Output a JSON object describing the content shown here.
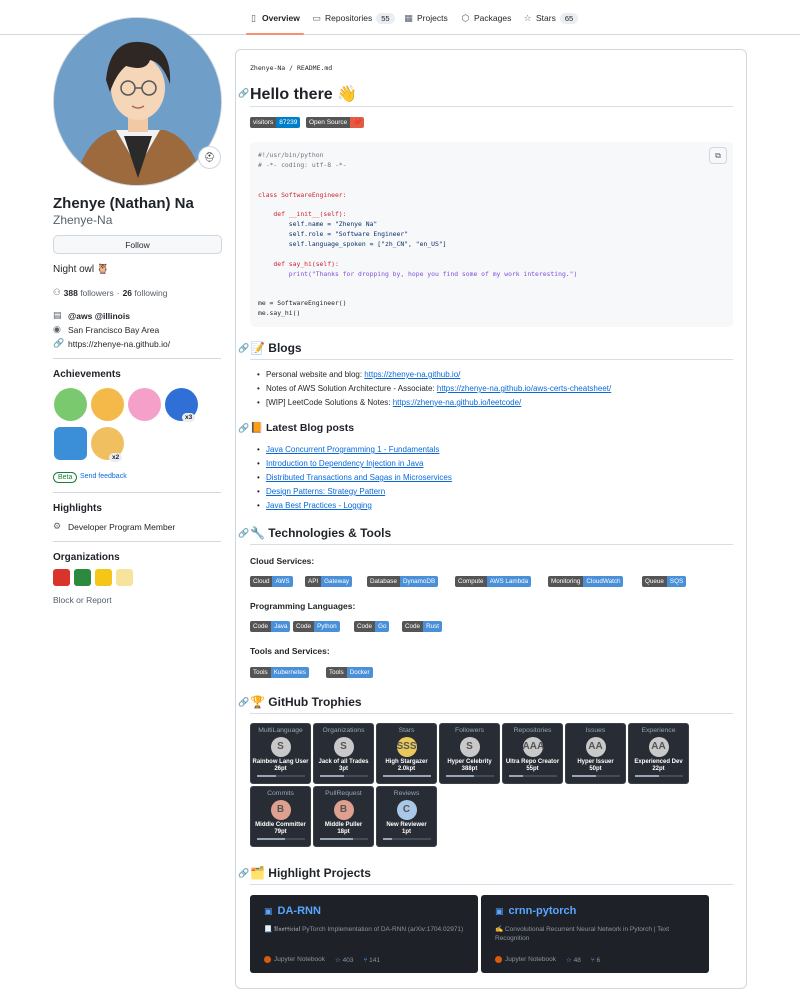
{
  "nav": {
    "tabs": [
      {
        "label": "Overview",
        "icon": "book-icon"
      },
      {
        "label": "Repositories",
        "icon": "repo-icon",
        "count": "55"
      },
      {
        "label": "Projects",
        "icon": "table-icon"
      },
      {
        "label": "Packages",
        "icon": "package-icon"
      },
      {
        "label": "Stars",
        "icon": "star-icon",
        "count": "65"
      }
    ]
  },
  "profile": {
    "name": "Zhenye (Nathan) Na",
    "login": "Zhenye-Na",
    "follow_label": "Follow",
    "bio": "Night owl 🦉",
    "followers_count": "388",
    "followers_label": "followers",
    "following_count": "26",
    "following_label": "following",
    "separator": "·",
    "company": "@aws @illinois",
    "location": "San Francisco Bay Area",
    "website": "https://zhenye-na.github.io/"
  },
  "achievements": {
    "title": "Achievements",
    "badges": [
      {
        "name": "pair-extraordinaire",
        "color": "#7bc96f"
      },
      {
        "name": "starstruck",
        "color": "#f5b94a"
      },
      {
        "name": "yolo",
        "color": "#f5a0c8"
      },
      {
        "name": "pull-shark",
        "color": "#2f6fd6",
        "count": "x3"
      },
      {
        "name": "arctic-code-vault",
        "color": "#3b8fd9"
      },
      {
        "name": "quickdraw",
        "color": "#f0c060",
        "count": "x2"
      }
    ],
    "beta_label": "Beta",
    "feedback_label": "Send feedback"
  },
  "highlights": {
    "title": "Highlights",
    "item": "Developer Program Member"
  },
  "organizations": {
    "title": "Organizations",
    "orgs": [
      {
        "color": "#d9342b"
      },
      {
        "color": "#2b8a3e"
      },
      {
        "color": "#f5c518"
      },
      {
        "color": "#f7e39c"
      }
    ],
    "block_label": "Block or Report"
  },
  "readme": {
    "path_user": "Zhenye-Na",
    "path_sep": "/",
    "path_file": "README.md",
    "title": "Hello there 👋",
    "badges": [
      {
        "left": "visitors",
        "right": "87239",
        "color": "#007ec6"
      },
      {
        "left": "Open Source",
        "right": "❤️",
        "color": "#e05d44"
      }
    ],
    "code_lines": [
      {
        "t": "#!/usr/bin/python",
        "c": "c-com"
      },
      {
        "t": "# -*- coding: utf-8 -*-",
        "c": "c-com"
      },
      {
        "t": "",
        "c": ""
      },
      {
        "t": "",
        "c": ""
      },
      {
        "t": "class SoftwareEngineer:",
        "c": "c-kw"
      },
      {
        "t": "",
        "c": ""
      },
      {
        "t": "    def __init__(self):",
        "c": "c-kw"
      },
      {
        "t": "        self.name = \"Zhenye Na\"",
        "c": "c-str"
      },
      {
        "t": "        self.role = \"Software Engineer\"",
        "c": "c-str"
      },
      {
        "t": "        self.language_spoken = [\"zh_CN\", \"en_US\"]",
        "c": "c-str"
      },
      {
        "t": "",
        "c": ""
      },
      {
        "t": "    def say_hi(self):",
        "c": "c-kw"
      },
      {
        "t": "        print(\"Thanks for dropping by, hope you find some of my work interesting.\")",
        "c": "c-fn"
      },
      {
        "t": "",
        "c": ""
      },
      {
        "t": "",
        "c": ""
      },
      {
        "t": "me = SoftwareEngineer()",
        "c": ""
      },
      {
        "t": "me.say_hi()",
        "c": ""
      }
    ],
    "blogs_title": "📝 Blogs",
    "blogs": [
      {
        "pre": "Personal website and blog: ",
        "link": "https://zhenye-na.github.io/"
      },
      {
        "pre": "Notes of AWS Solution Architecture - Associate: ",
        "link": "https://zhenye-na.github.io/aws-certs-cheatsheet/"
      },
      {
        "pre": "[WIP] LeetCode Solutions & Notes: ",
        "link": "https://zhenye-na.github.io/leetcode/"
      }
    ],
    "latest_title": "📙 Latest Blog posts",
    "latest": [
      "Java Concurrent Programming 1 - Fundamentals",
      "Introduction to Dependency Injection in Java",
      "Distributed Transactions and Sagas in Microservices",
      "Design Patterns: Strategy Pattern",
      "Java Best Practices - Logging"
    ],
    "tech_title": "🔧 Technologies & Tools",
    "cloud_title": "Cloud Services:",
    "cloud": [
      {
        "l": "Cloud",
        "r": "AWS"
      },
      {
        "l": "API",
        "r": "Gateway"
      },
      {
        "l": "Database",
        "r": "DynamoDB"
      },
      {
        "l": "Compute",
        "r": "AWS Lambda"
      },
      {
        "l": "Monitoring",
        "r": "CloudWatch"
      },
      {
        "l": "Queue",
        "r": "SQS"
      }
    ],
    "lang_title": "Programming Languages:",
    "langs": [
      {
        "l": "Code",
        "r": "Java"
      },
      {
        "l": "Code",
        "r": "Python"
      },
      {
        "l": "Code",
        "r": "Go"
      },
      {
        "l": "Code",
        "r": "Rust"
      }
    ],
    "tools_title": "Tools and Services:",
    "tools": [
      {
        "l": "Tools",
        "r": "Kubernetes"
      },
      {
        "l": "Tools",
        "r": "Docker"
      }
    ],
    "trophies_title": "🏆 GitHub Trophies",
    "trophies": [
      {
        "title": "MultiLanguage",
        "rank": "S",
        "name": "Rainbow Lang User",
        "pts": "26pt",
        "fill": 0.4
      },
      {
        "title": "Organizations",
        "rank": "S",
        "name": "Jack of all Trades",
        "pts": "3pt",
        "fill": 0.5
      },
      {
        "title": "Stars",
        "rank": "SSS",
        "name": "High Stargazer",
        "pts": "2.0kpt",
        "fill": 1.0
      },
      {
        "title": "Followers",
        "rank": "S",
        "name": "Hyper Celebrity",
        "pts": "388pt",
        "fill": 0.6
      },
      {
        "title": "Repositories",
        "rank": "AAA",
        "name": "Ultra Repo Creator",
        "pts": "55pt",
        "fill": 0.3
      },
      {
        "title": "Issues",
        "rank": "AA",
        "name": "Hyper Issuer",
        "pts": "50pt",
        "fill": 0.5
      },
      {
        "title": "Experience",
        "rank": "AA",
        "name": "Experienced Dev",
        "pts": "22pt",
        "fill": 0.5
      },
      {
        "title": "Commits",
        "rank": "B",
        "name": "Middle Committer",
        "pts": "79pt",
        "fill": 0.6
      },
      {
        "title": "PullRequest",
        "rank": "B",
        "name": "Middle Puller",
        "pts": "18pt",
        "fill": 0.7
      },
      {
        "title": "Reviews",
        "rank": "C",
        "name": "New Reviewer",
        "pts": "1pt",
        "fill": 0.2
      }
    ],
    "projects_title": "🗂️ Highlight Projects",
    "projects": [
      {
        "name": "DA-RNN",
        "desc": "📃 𝖀𝖓𝖔𝖋𝖋𝖎𝖈𝖎𝖆𝖑 PyTorch Implementation of DA-RNN (arXiv:1704.02971)",
        "lang": "Jupyter Notebook",
        "stars": "403",
        "forks": "141"
      },
      {
        "name": "crnn-pytorch",
        "desc": "✍️ Convolutional Recurrent Neural Network in Pytorch | Text Recognition",
        "lang": "Jupyter Notebook",
        "stars": "48",
        "forks": "6"
      }
    ]
  },
  "colors": {
    "accent": "#fd8c73",
    "link": "#0969da",
    "badge_blue": "#4a90d9"
  }
}
